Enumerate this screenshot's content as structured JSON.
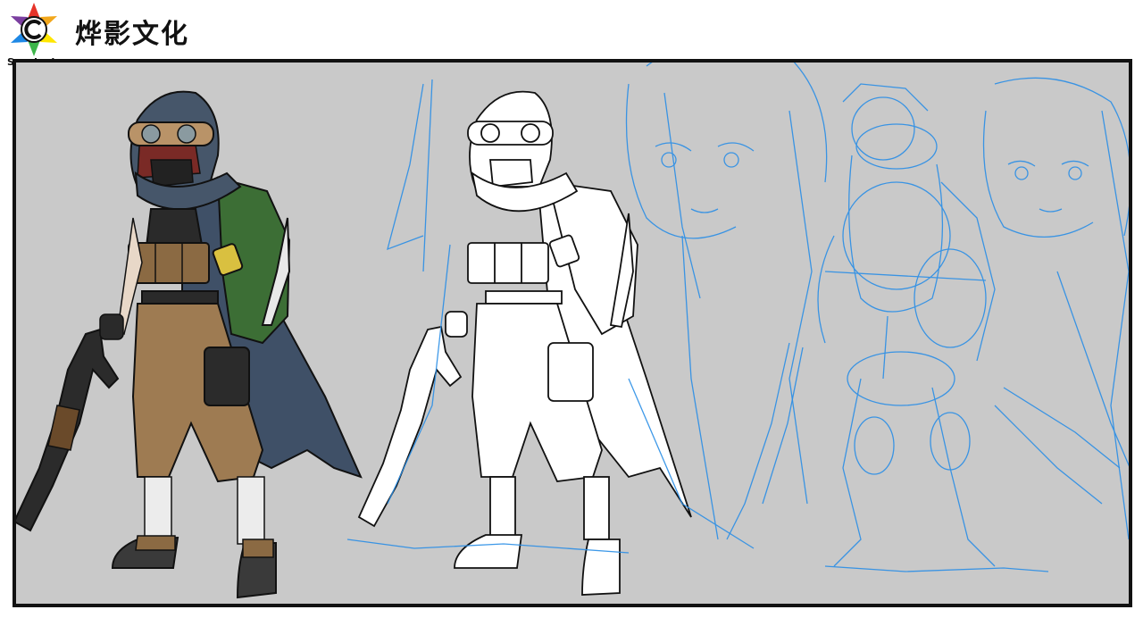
{
  "brand": {
    "name": "烨影文化",
    "sub": "Sunshadow",
    "emblem_icon": "sun-star-c-icon",
    "emblem_colors": [
      "#e63329",
      "#f2a71b",
      "#ffe600",
      "#3db54a",
      "#1e88e5",
      "#7b3fa0"
    ]
  },
  "artboard": {
    "background": "#c9c9c9",
    "border_color": "#111111",
    "panels": [
      {
        "name": "colored-character",
        "icon": "colored-figure-icon"
      },
      {
        "name": "lineart-character",
        "icon": "lineart-figure-icon"
      },
      {
        "name": "sketch-faces",
        "icon": "sketch-face-icon"
      },
      {
        "name": "sketch-figure",
        "icon": "sketch-figure-icon"
      }
    ],
    "palette": {
      "hood": "#46566a",
      "cloak": "#3f5067",
      "backpack": "#3c6e35",
      "pouches": "#8b6a43",
      "pants": "#9e7b52",
      "hair": "#7a2a26",
      "goggles": "#b99368",
      "boots": "#3a3a3a",
      "bandage": "#ececec",
      "rifle": "#2b2b2b",
      "rifle_wood": "#6a4a2a",
      "sketch_blue": "#2a8ee6",
      "line_black": "#111111"
    }
  }
}
